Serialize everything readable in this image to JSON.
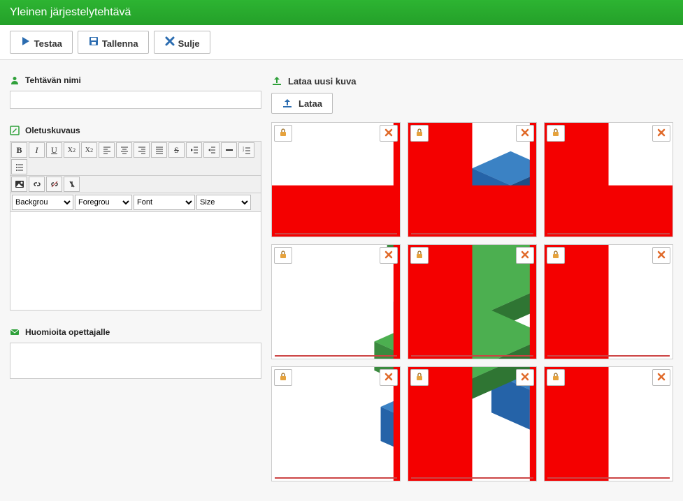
{
  "header": {
    "title": "Yleinen järjestelytehtävä"
  },
  "toolbar": {
    "test_label": "Testaa",
    "save_label": "Tallenna",
    "close_label": "Sulje"
  },
  "left": {
    "name_label": "Tehtävän nimi",
    "name_value": "",
    "desc_label": "Oletuskuvaus",
    "rte": {
      "buttons": [
        "B",
        "I",
        "U",
        "X₂",
        "X²",
        "align-left",
        "align-center",
        "align-right",
        "justify",
        "strike",
        "outdent",
        "indent",
        "hr",
        "ol",
        "ul",
        "image",
        "link",
        "unlink",
        "clear"
      ],
      "selects": {
        "background": {
          "label": "Backgrou",
          "options": [
            "Backgrou"
          ]
        },
        "foreground": {
          "label": "Foregrou",
          "options": [
            "Foregrou"
          ]
        },
        "font": {
          "label": "Font",
          "options": [
            "Font"
          ]
        },
        "size": {
          "label": "Size",
          "options": [
            "Size"
          ]
        }
      },
      "content": ""
    },
    "notes_label": "Huomioita opettajalle",
    "notes_value": ""
  },
  "right": {
    "upload_label": "Lataa uusi kuva",
    "upload_button": "Lataa",
    "tiles": [
      {
        "lock": "lock-icon",
        "delete": "delete-icon"
      },
      {
        "lock": "lock-icon",
        "delete": "delete-icon"
      },
      {
        "lock": "lock-icon",
        "delete": "delete-icon"
      },
      {
        "lock": "lock-icon",
        "delete": "delete-icon"
      },
      {
        "lock": "lock-icon",
        "delete": "delete-icon"
      },
      {
        "lock": "lock-icon",
        "delete": "delete-icon"
      },
      {
        "lock": "lock-icon",
        "delete": "delete-icon"
      },
      {
        "lock": "lock-icon",
        "delete": "delete-icon"
      },
      {
        "lock": "lock-icon",
        "delete": "delete-icon"
      }
    ]
  },
  "colors": {
    "accent_green": "#2db432",
    "accent_blue": "#2b6cb0",
    "delete_orange": "#e06a2a",
    "overlay_red": "#e11"
  }
}
